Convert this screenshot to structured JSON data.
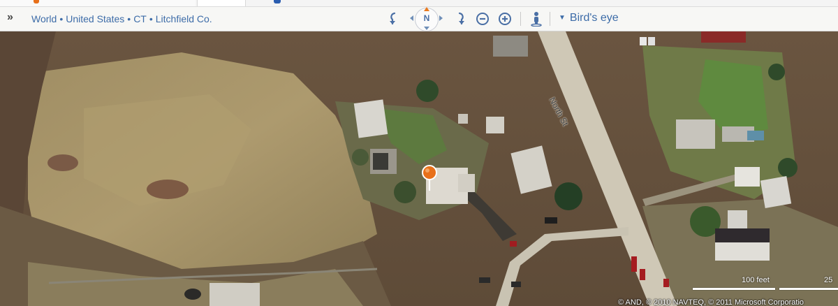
{
  "breadcrumb": {
    "items": [
      "World",
      "United States",
      "CT",
      "Litchfield Co."
    ],
    "separator": "•"
  },
  "nav": {
    "compass_label": "N",
    "view_mode_label": "Bird's eye"
  },
  "map": {
    "street_name": "North St",
    "scale_primary": "100 feet",
    "scale_secondary": "25",
    "copyright": "© AND, © 2010 NAVTEQ, © 2011 Microsoft Corporatio"
  },
  "icons": {
    "expand": "double-chevron-right-icon",
    "rotate_left": "rotate-left-icon",
    "rotate_right": "rotate-right-icon",
    "zoom_out": "zoom-out-icon",
    "zoom_in": "zoom-in-icon",
    "streetside": "pegman-icon",
    "pin": "location-pin-icon"
  },
  "colors": {
    "link": "#3d6ca8",
    "pin": "#e8701a",
    "accent": "#e8791e"
  }
}
